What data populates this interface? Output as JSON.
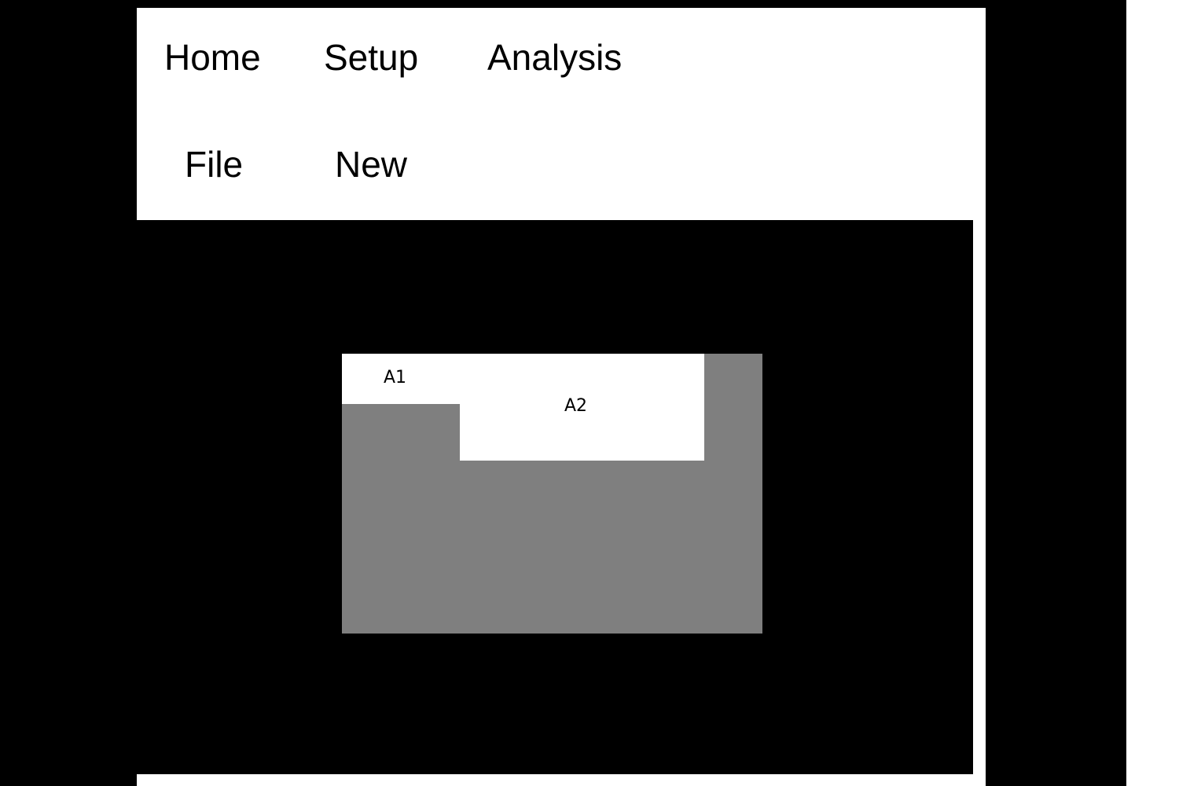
{
  "menu": {
    "top_row": [
      {
        "label": "Home"
      },
      {
        "label": "Setup"
      },
      {
        "label": "Analysis"
      }
    ],
    "second_row": [
      {
        "label": "File"
      },
      {
        "label": "New"
      }
    ]
  },
  "canvas": {
    "regions": [
      {
        "label": "A1"
      },
      {
        "label": "A2"
      }
    ],
    "colors": {
      "background": "#000000",
      "block": "#7f7f7f",
      "region": "#ffffff"
    }
  }
}
